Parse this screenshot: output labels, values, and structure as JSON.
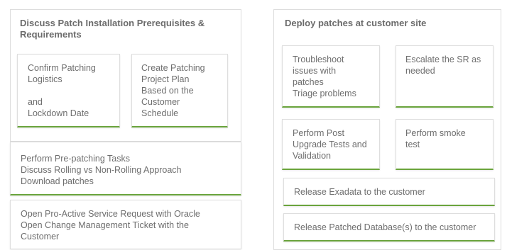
{
  "accent_color": "#6aa43c",
  "left": {
    "title_lines": [
      "Discuss Patch Installation Prerequisites &",
      "Requirements"
    ],
    "cards": [
      {
        "lines": [
          "Confirm Patching",
          "Logistics",
          "",
          "and",
          "Lockdown Date"
        ]
      },
      {
        "lines": [
          "Create Patching",
          "Project Plan",
          "Based on the",
          "Customer",
          "Schedule"
        ]
      }
    ],
    "wide_cards": [
      {
        "lines": [
          "Perform Pre-patching Tasks",
          "Discuss Rolling vs Non-Rolling Approach",
          "Download patches"
        ]
      },
      {
        "lines": [
          "Open Pro-Active Service Request with Oracle",
          "Open Change Management Ticket with the",
          "Customer"
        ]
      }
    ]
  },
  "right": {
    "title": "Deploy patches at customer site",
    "cards": [
      {
        "lines": [
          "Troubleshoot",
          "issues with",
          "patches",
          "Triage problems"
        ]
      },
      {
        "lines": [
          "Escalate the SR as",
          "needed"
        ]
      },
      {
        "lines": [
          "Perform Post",
          "Upgrade Tests and",
          "Validation"
        ]
      },
      {
        "lines": [
          "Perform smoke",
          "test"
        ]
      }
    ],
    "wide_cards": [
      {
        "text": "Release Exadata to the customer"
      },
      {
        "text": "Release Patched Database(s) to the customer"
      }
    ]
  }
}
